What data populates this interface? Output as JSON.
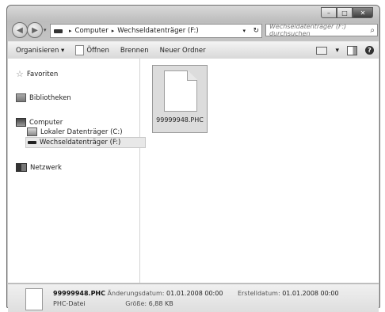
{
  "window": {
    "caption_buttons": [
      "–",
      "□",
      "✕"
    ]
  },
  "address": {
    "crumbs": [
      "Computer",
      "Wechseldatenträger (F:)"
    ],
    "search_placeholder": "Wechseldatenträger (F:) durchsuchen"
  },
  "toolbar": {
    "organize": "Organisieren ▾",
    "open": "Öffnen",
    "burn": "Brennen",
    "new_folder": "Neuer Ordner"
  },
  "nav": {
    "favorites": "Favoriten",
    "libraries": "Bibliotheken",
    "computer": "Computer",
    "local_drive": "Lokaler Datenträger (C:)",
    "removable_drive": "Wechseldatenträger (F:)",
    "network": "Netzwerk"
  },
  "files": [
    {
      "name": "99999948.PHC"
    }
  ],
  "details": {
    "name": "99999948.PHC",
    "type": "PHC-Datei",
    "modified_label": "Änderungsdatum:",
    "modified_value": "01.01.2008 00:00",
    "created_label": "Erstelldatum:",
    "created_value": "01.01.2008 00:00",
    "size_label": "Größe:",
    "size_value": "6,88 KB"
  },
  "icons": {
    "help": "?",
    "refresh": "↻",
    "search": "⌕",
    "dropdown": "▾"
  }
}
